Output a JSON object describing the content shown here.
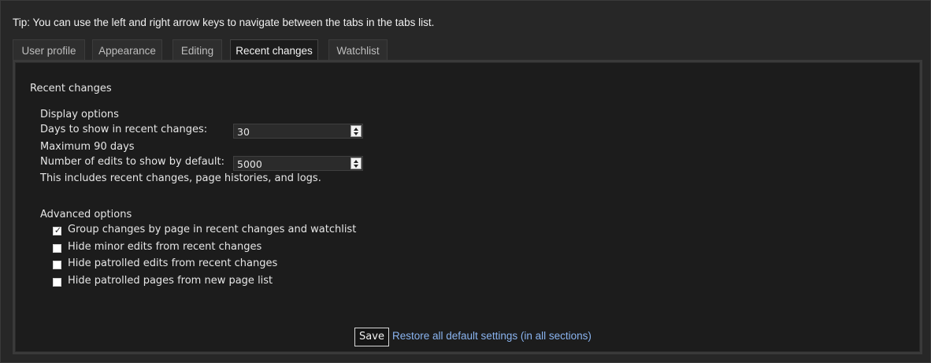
{
  "tip": "Tip: You can use the left and right arrow keys to navigate between the tabs in the tabs list.",
  "tabs": [
    {
      "label": "User profile"
    },
    {
      "label": "Appearance"
    },
    {
      "label": "Editing"
    },
    {
      "label": "Recent changes",
      "active": true
    },
    {
      "label": "Watchlist"
    }
  ],
  "section": {
    "title": "Recent changes",
    "display_options": {
      "heading": "Display options",
      "days_label": "Days to show in recent changes:",
      "days_value": "30",
      "days_help": "Maximum 90 days",
      "edits_label": "Number of edits to show by default:",
      "edits_value": "5000",
      "edits_help": "This includes recent changes, page histories, and logs."
    },
    "advanced_options": {
      "heading": "Advanced options",
      "options": [
        {
          "label": "Group changes by page in recent changes and watchlist",
          "checked": true
        },
        {
          "label": "Hide minor edits from recent changes",
          "checked": false
        },
        {
          "label": "Hide patrolled edits from recent changes",
          "checked": false
        },
        {
          "label": "Hide patrolled pages from new page list",
          "checked": false
        }
      ]
    }
  },
  "footer": {
    "save_label": "Save",
    "restore_label": "Restore all default settings (in all sections)"
  },
  "colors": {
    "background": "#262626",
    "panel": "#1c1c1c",
    "link": "#8ab4f0"
  }
}
